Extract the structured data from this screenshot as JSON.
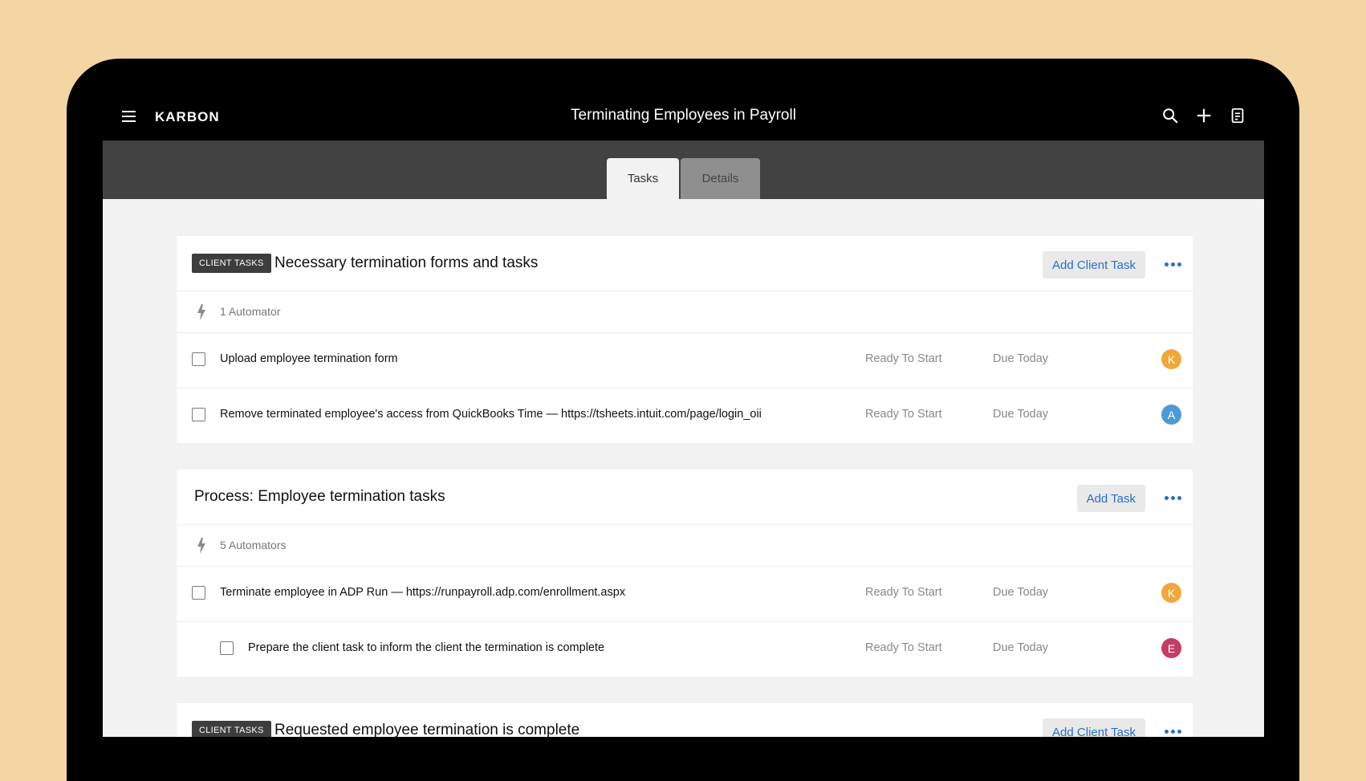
{
  "app": {
    "brand": "KARBON",
    "title": "Terminating Employees in Payroll"
  },
  "tabs": [
    {
      "label": "Tasks"
    },
    {
      "label": "Details"
    }
  ],
  "icons": {
    "menu": "hamburger-icon",
    "search": "search-icon",
    "add": "plus-icon",
    "notes": "note-icon",
    "automator": "bolt-icon"
  },
  "colors": {
    "accent": "#2a6fc7",
    "avatar_k": "#f0a83a",
    "avatar_a": "#4b9ad6",
    "avatar_e": "#c43c63"
  },
  "sections": [
    {
      "badge": "CLIENT TASKS",
      "title": "Necessary termination forms and tasks",
      "action": "Add Client Task",
      "automators": "1 Automator",
      "tasks": [
        {
          "text": "Upload employee termination form",
          "status": "Ready To Start",
          "due": "Due Today",
          "avatar": "K"
        },
        {
          "text": "Remove terminated employee's access from QuickBooks Time — https://tsheets.intuit.com/page/login_oii",
          "status": "Ready To Start",
          "due": "Due Today",
          "avatar": "A"
        }
      ]
    },
    {
      "title": "Process: Employee termination tasks",
      "action": "Add Task",
      "automators": "5 Automators",
      "tasks": [
        {
          "text": "Terminate employee in ADP Run — https://runpayroll.adp.com/enrollment.aspx",
          "status": "Ready To Start",
          "due": "Due Today",
          "avatar": "K"
        },
        {
          "text": "Prepare the client task to inform the client the termination is complete",
          "status": "Ready To Start",
          "due": "Due Today",
          "avatar": "E"
        }
      ]
    },
    {
      "badge": "CLIENT TASKS",
      "title": "Requested employee termination is complete",
      "action": "Add Client Task"
    }
  ]
}
